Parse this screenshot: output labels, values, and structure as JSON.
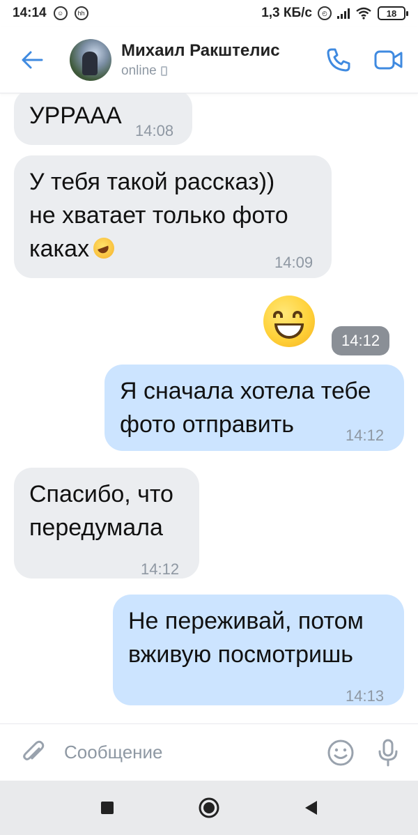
{
  "status_bar": {
    "time": "14:14",
    "extra_icon": "hh",
    "net_speed": "1,3 КБ/с",
    "battery": "18"
  },
  "header": {
    "contact_name": "Михаил Ракштелис",
    "status": "online",
    "icons": {
      "back": "arrow-left-icon",
      "call": "phone-icon",
      "video": "video-camera-icon"
    },
    "accent_color": "#3f8ae0"
  },
  "messages": [
    {
      "direction": "in",
      "lines": [
        "УРРААА"
      ],
      "time": "14:08"
    },
    {
      "direction": "in",
      "lines": [
        "У тебя такой рассказ))",
        "не хватает только фото",
        "каках"
      ],
      "emoji": "rolling-on-floor-laughing",
      "time": "14:09"
    },
    {
      "direction": "out",
      "type": "sticker",
      "emoji": "grinning-face-with-smiling-eyes",
      "time": "14:12"
    },
    {
      "direction": "out",
      "lines": [
        "Я сначала хотела тебе",
        "фото отправить"
      ],
      "time": "14:12"
    },
    {
      "direction": "in",
      "lines": [
        "Спасибо, что",
        "передумала"
      ],
      "time": "14:12"
    },
    {
      "direction": "out",
      "lines": [
        "Не переживай, потом",
        "вживую посмотришь"
      ],
      "time": "14:13"
    }
  ],
  "composer": {
    "placeholder": "Сообщение",
    "icons": {
      "attach": "paperclip-icon",
      "emoji": "smiley-icon",
      "voice": "microphone-icon"
    }
  },
  "colors": {
    "incoming_bubble": "#ebedf0",
    "outgoing_bubble": "#cce4ff",
    "timestamp": "#8e97a2"
  }
}
